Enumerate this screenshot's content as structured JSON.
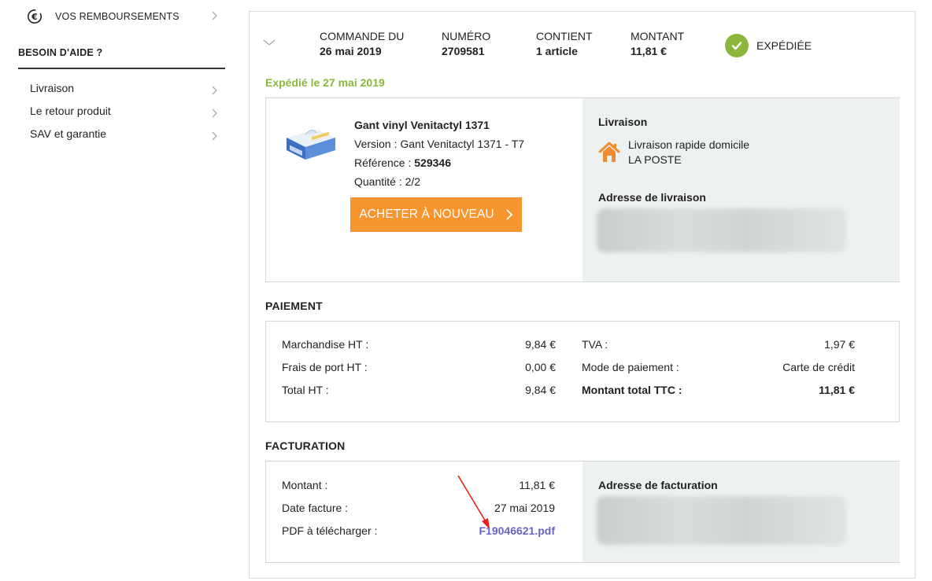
{
  "sidebar": {
    "refunds_label": "VOS REMBOURSEMENTS",
    "help_title": "BESOIN D'AIDE ?",
    "links": [
      {
        "label": "Livraison"
      },
      {
        "label": "Le retour produit"
      },
      {
        "label": "SAV et garantie"
      }
    ]
  },
  "order": {
    "date_label": "COMMANDE DU",
    "date_value": "26 mai 2019",
    "number_label": "NUMÉRO",
    "number_value": "2709581",
    "contains_label": "CONTIENT",
    "contains_value": "1 article",
    "amount_label": "MONTANT",
    "amount_value": "11,81 €",
    "status": "EXPÉDIÉE",
    "shipped_line": "Expédié le 27 mai 2019"
  },
  "product": {
    "name": "Gant vinyl Venitactyl 1371",
    "version_text": "Version : Gant Venitactyl 1371 - T7",
    "reference_label": "Référence : ",
    "reference_value": "529346",
    "quantity_text": "Quantité : 2/2",
    "buy_again_label": "ACHETER À NOUVEAU"
  },
  "delivery": {
    "title": "Livraison",
    "method": "Livraison rapide domicile",
    "carrier": "LA POSTE",
    "address_title": "Adresse de livraison"
  },
  "payment": {
    "title": "PAIEMENT",
    "rows_left": [
      {
        "label": "Marchandise HT :",
        "value": "9,84 €"
      },
      {
        "label": "Frais de port HT :",
        "value": "0,00 €"
      },
      {
        "label": "Total HT :",
        "value": "9,84 €"
      }
    ],
    "rows_right": [
      {
        "label": "TVA :",
        "value": "1,97 €"
      },
      {
        "label": "Mode de paiement :",
        "value": "Carte de crédit"
      },
      {
        "label": "Montant total TTC :",
        "value": "11,81 €"
      }
    ]
  },
  "billing": {
    "title": "FACTURATION",
    "amount_label": "Montant :",
    "amount_value": "11,81 €",
    "date_label": "Date facture :",
    "date_value": "27 mai 2019",
    "pdf_label": "PDF à télécharger :",
    "pdf_file": "F19046621.pdf",
    "address_title": "Adresse de facturation"
  },
  "colors": {
    "accent_green": "#8db63c",
    "button_orange": "#f7952e",
    "link_purple": "#6c63c4",
    "annotation_red": "#e8201a"
  }
}
